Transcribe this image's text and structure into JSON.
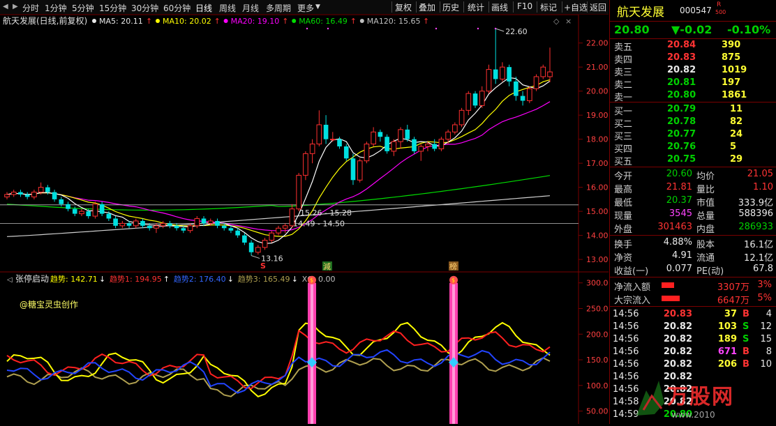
{
  "toolbar": {
    "left_tabs": [
      "分时",
      "1分钟",
      "5分钟",
      "15分钟",
      "30分钟",
      "60分钟",
      "日线",
      "周线",
      "月线",
      "多周期",
      "更多"
    ],
    "active_tab": "日线",
    "right_buttons": [
      "复权",
      "叠加",
      "历史",
      "统计",
      "画线",
      "F10",
      "标记",
      "+自选",
      "返回"
    ]
  },
  "chart": {
    "title": "航天发展(日线,前复权)",
    "ma": [
      {
        "label": "MA5: 20.11",
        "arrow": "↑",
        "color": "#e8e8e8"
      },
      {
        "label": "MA10: 20.02",
        "arrow": "↑",
        "color": "#ffff00"
      },
      {
        "label": "MA20: 19.10",
        "arrow": "↑",
        "color": "#ff00ff"
      },
      {
        "label": "MA60: 16.49",
        "arrow": "↑",
        "color": "#00dd00"
      },
      {
        "label": "MA120: 15.65",
        "arrow": "↑",
        "color": "#c0c0c0"
      }
    ],
    "ma_arrow_color": "#ff3333",
    "price_axis": [
      "22.00",
      "21.00",
      "20.00",
      "19.00",
      "18.00",
      "17.00",
      "16.00",
      "15.00",
      "14.00",
      "13.00"
    ],
    "annotations": {
      "high": "22.60",
      "low": "13.16",
      "range1": "15.26 - 15.28",
      "range2": "14.49 - 14.50",
      "mark_s": "S",
      "mark_jian": "減",
      "mark_bang": "榜"
    }
  },
  "chart_data": [
    {
      "type": "bar",
      "title": "航天发展(日线,前复权)",
      "categories": [],
      "series": [
        {
          "name": "MA5",
          "values": [
            20.11
          ]
        },
        {
          "name": "MA10",
          "values": [
            20.02
          ]
        },
        {
          "name": "MA20",
          "values": [
            19.1
          ]
        },
        {
          "name": "MA60",
          "values": [
            16.49
          ]
        },
        {
          "name": "MA120",
          "values": [
            15.65
          ]
        }
      ],
      "ylim": [
        12.8,
        22.6
      ],
      "yticks": [
        13,
        14,
        15,
        16,
        17,
        18,
        19,
        20,
        21,
        22
      ],
      "high": 22.6,
      "low": 13.16,
      "grid": false,
      "candles": [
        [
          15.6,
          15.8,
          15.5,
          15.7
        ],
        [
          15.7,
          15.9,
          15.6,
          15.8
        ],
        [
          15.8,
          15.9,
          15.6,
          15.7
        ],
        [
          15.7,
          15.8,
          15.5,
          15.6
        ],
        [
          15.6,
          15.9,
          15.5,
          15.8
        ],
        [
          15.8,
          16.2,
          15.7,
          16.0
        ],
        [
          16.0,
          16.1,
          15.7,
          15.8
        ],
        [
          15.8,
          15.9,
          15.4,
          15.5
        ],
        [
          15.5,
          15.6,
          15.2,
          15.3
        ],
        [
          15.3,
          15.4,
          15.0,
          15.1
        ],
        [
          15.1,
          15.2,
          14.8,
          14.9
        ],
        [
          14.9,
          15.1,
          14.8,
          15.0
        ],
        [
          15.0,
          15.1,
          14.7,
          14.8
        ],
        [
          14.8,
          15.4,
          14.7,
          15.3
        ],
        [
          15.3,
          15.4,
          14.8,
          14.9
        ],
        [
          14.9,
          15.0,
          14.6,
          14.7
        ],
        [
          14.7,
          14.8,
          14.3,
          14.4
        ],
        [
          14.4,
          14.6,
          14.3,
          14.5
        ],
        [
          14.5,
          14.6,
          14.3,
          14.4
        ],
        [
          14.4,
          14.7,
          14.3,
          14.6
        ],
        [
          14.6,
          14.7,
          14.3,
          14.4
        ],
        [
          14.4,
          14.5,
          14.2,
          14.3
        ],
        [
          14.3,
          14.5,
          14.1,
          14.4
        ],
        [
          14.4,
          14.6,
          14.3,
          14.5
        ],
        [
          14.5,
          14.6,
          14.3,
          14.4
        ],
        [
          14.4,
          14.5,
          14.2,
          14.3
        ],
        [
          14.3,
          14.4,
          14.1,
          14.2
        ],
        [
          14.2,
          14.5,
          14.1,
          14.4
        ],
        [
          14.4,
          14.8,
          14.3,
          14.7
        ],
        [
          14.7,
          14.8,
          14.4,
          14.5
        ],
        [
          14.5,
          14.7,
          14.4,
          14.6
        ],
        [
          14.6,
          14.7,
          14.3,
          14.4
        ],
        [
          14.4,
          14.5,
          14.2,
          14.3
        ],
        [
          14.3,
          14.4,
          14.1,
          14.2
        ],
        [
          14.2,
          14.3,
          13.9,
          14.0
        ],
        [
          14.0,
          14.1,
          13.6,
          13.7
        ],
        [
          13.7,
          13.8,
          13.16,
          13.3
        ],
        [
          13.3,
          13.6,
          13.2,
          13.5
        ],
        [
          13.5,
          13.9,
          13.4,
          13.8
        ],
        [
          13.8,
          14.2,
          13.7,
          14.1
        ],
        [
          14.1,
          14.4,
          14.0,
          14.3
        ],
        [
          14.3,
          14.5,
          14.1,
          14.4
        ],
        [
          14.4,
          15.3,
          14.3,
          15.1
        ],
        [
          15.1,
          16.6,
          15.0,
          16.5
        ],
        [
          16.5,
          17.5,
          16.3,
          17.4
        ],
        [
          17.4,
          18.0,
          17.0,
          17.8
        ],
        [
          17.8,
          19.2,
          17.7,
          18.6
        ],
        [
          18.6,
          19.0,
          17.8,
          18.0
        ],
        [
          18.0,
          18.3,
          17.9,
          18.0
        ],
        [
          18.0,
          18.1,
          17.6,
          17.7
        ],
        [
          17.7,
          17.8,
          17.1,
          17.2
        ],
        [
          17.2,
          17.4,
          16.1,
          16.3
        ],
        [
          16.3,
          17.2,
          16.2,
          17.1
        ],
        [
          17.1,
          17.9,
          17.0,
          17.8
        ],
        [
          17.8,
          18.5,
          17.7,
          18.3
        ],
        [
          18.3,
          18.4,
          17.9,
          18.1
        ],
        [
          18.1,
          18.2,
          17.4,
          17.5
        ],
        [
          17.5,
          18.0,
          17.3,
          17.9
        ],
        [
          17.9,
          18.5,
          17.6,
          18.4
        ],
        [
          18.4,
          18.6,
          17.9,
          18.0
        ],
        [
          18.0,
          18.1,
          17.4,
          17.5
        ],
        [
          17.5,
          17.8,
          17.1,
          17.7
        ],
        [
          17.7,
          17.9,
          17.5,
          17.8
        ],
        [
          17.8,
          18.0,
          17.5,
          17.6
        ],
        [
          17.6,
          18.1,
          17.5,
          18.0
        ],
        [
          18.0,
          18.4,
          17.8,
          18.3
        ],
        [
          18.3,
          18.7,
          18.2,
          18.6
        ],
        [
          18.6,
          19.3,
          18.5,
          19.2
        ],
        [
          19.2,
          20.0,
          19.0,
          19.9
        ],
        [
          19.9,
          20.0,
          19.3,
          19.4
        ],
        [
          19.4,
          20.2,
          19.3,
          20.0
        ],
        [
          20.0,
          21.1,
          19.9,
          20.9
        ],
        [
          20.9,
          22.6,
          20.3,
          20.5
        ],
        [
          20.5,
          21.2,
          20.4,
          21.0
        ],
        [
          21.0,
          21.1,
          20.2,
          20.4
        ],
        [
          20.4,
          20.6,
          19.6,
          19.8
        ],
        [
          19.8,
          20.0,
          19.4,
          19.6
        ],
        [
          19.6,
          20.2,
          19.5,
          20.1
        ],
        [
          20.1,
          20.7,
          20.0,
          20.6
        ],
        [
          20.6,
          21.1,
          20.5,
          21.0
        ],
        [
          20.6,
          21.81,
          20.37,
          20.8
        ]
      ]
    },
    {
      "type": "line",
      "title": "张停启动",
      "series": [
        {
          "name": "趋势",
          "values": [
            142.71
          ]
        },
        {
          "name": "趋势1",
          "values": [
            194.95
          ]
        },
        {
          "name": "趋势2",
          "values": [
            176.4
          ]
        },
        {
          "name": "趋势3",
          "values": [
            165.49
          ]
        },
        {
          "name": "XG",
          "values": [
            0.0
          ]
        }
      ],
      "ylim": [
        25,
        320
      ],
      "yticks": [
        50,
        100,
        150,
        200,
        250,
        300
      ]
    }
  ],
  "indicator": {
    "name": "张停启动",
    "items": [
      {
        "label": "趋势: 142.71",
        "color": "#ffff00",
        "arrow": "↓"
      },
      {
        "label": "趋势1: 194.95",
        "color": "#ff3333",
        "arrow": "↑"
      },
      {
        "label": "趋势2: 176.40",
        "color": "#3366ff",
        "arrow": "↓"
      },
      {
        "label": "趋势3: 165.49",
        "color": "#b0a050",
        "arrow": "↓"
      },
      {
        "label": "XG: 0.00",
        "color": "#c0c0c0",
        "arrow": ""
      }
    ],
    "watermark": "@糖宝灵虫创作",
    "axis": [
      "300.0",
      "250.0",
      "200.0",
      "150.0",
      "100.0",
      "50.00"
    ]
  },
  "quote": {
    "name": "航天发展",
    "code": "000547",
    "badge_r": "R",
    "badge_num": "500",
    "price": "20.80",
    "change": "▼-0.02",
    "pct": "-0.10%",
    "asks": [
      {
        "label": "卖五",
        "price": "20.84",
        "vol": "390",
        "pc": "red"
      },
      {
        "label": "卖四",
        "price": "20.83",
        "vol": "875",
        "pc": "red"
      },
      {
        "label": "卖三",
        "price": "20.82",
        "vol": "1019",
        "pc": "wht"
      },
      {
        "label": "卖二",
        "price": "20.81",
        "vol": "197",
        "pc": "grn"
      },
      {
        "label": "卖一",
        "price": "20.80",
        "vol": "1861",
        "pc": "grn"
      }
    ],
    "bids": [
      {
        "label": "买一",
        "price": "20.79",
        "vol": "11",
        "pc": "grn"
      },
      {
        "label": "买二",
        "price": "20.78",
        "vol": "82",
        "pc": "grn"
      },
      {
        "label": "买三",
        "price": "20.77",
        "vol": "24",
        "pc": "grn"
      },
      {
        "label": "买四",
        "price": "20.76",
        "vol": "5",
        "pc": "grn"
      },
      {
        "label": "买五",
        "price": "20.75",
        "vol": "29",
        "pc": "grn"
      }
    ],
    "stats": [
      {
        "l1": "今开",
        "v1": "20.60",
        "c1": "grn",
        "l2": "均价",
        "v2": "21.05",
        "c2": "red"
      },
      {
        "l1": "最高",
        "v1": "21.81",
        "c1": "red",
        "l2": "量比",
        "v2": "1.10",
        "c2": "red"
      },
      {
        "l1": "最低",
        "v1": "20.37",
        "c1": "grn",
        "l2": "市值",
        "v2": "333.9亿",
        "c2": "wht"
      },
      {
        "l1": "现量",
        "v1": "3545",
        "c1": "mag",
        "l2": "总量",
        "v2": "588396",
        "c2": "wht"
      },
      {
        "l1": "外盘",
        "v1": "301463",
        "c1": "red",
        "l2": "内盘",
        "v2": "286933",
        "c2": "grn"
      }
    ],
    "stats2": [
      {
        "l1": "换手",
        "v1": "4.88%",
        "c1": "wht",
        "l2": "股本",
        "v2": "16.1亿",
        "c2": "wht"
      },
      {
        "l1": "净资",
        "v1": "4.91",
        "c1": "wht",
        "l2": "流通",
        "v2": "12.1亿",
        "c2": "wht"
      },
      {
        "l1": "收益(一)",
        "v1": "0.077",
        "c1": "wht",
        "l2": "PE(动)",
        "v2": "67.8",
        "c2": "wht"
      }
    ],
    "flows": [
      {
        "label": "净流入额",
        "value": "3307万",
        "pct": "3%",
        "bar": 0.6
      },
      {
        "label": "大宗流入",
        "value": "6647万",
        "pct": "5%",
        "bar": 0.85
      }
    ],
    "ticks": [
      {
        "t": "14:56",
        "p": "20.83",
        "pc": "red",
        "v": "37",
        "vc": "yel",
        "s": "B",
        "sc": "red",
        "n": "4"
      },
      {
        "t": "14:56",
        "p": "20.82",
        "pc": "wht",
        "v": "103",
        "vc": "yel",
        "s": "S",
        "sc": "grn",
        "n": "12"
      },
      {
        "t": "14:56",
        "p": "20.82",
        "pc": "wht",
        "v": "189",
        "vc": "yel",
        "s": "S",
        "sc": "grn",
        "n": "15"
      },
      {
        "t": "14:56",
        "p": "20.82",
        "pc": "wht",
        "v": "671",
        "vc": "mag",
        "s": "B",
        "sc": "red",
        "n": "8"
      },
      {
        "t": "14:56",
        "p": "20.82",
        "pc": "wht",
        "v": "206",
        "vc": "yel",
        "s": "B",
        "sc": "red",
        "n": "10"
      },
      {
        "t": "14:56",
        "p": "20.82",
        "pc": "wht",
        "v": "",
        "vc": "yel",
        "s": "",
        "sc": "grn",
        "n": ""
      },
      {
        "t": "14:56",
        "p": "20.82",
        "pc": "wht",
        "v": "",
        "vc": "yel",
        "s": "",
        "sc": "grn",
        "n": ""
      },
      {
        "t": "14:58",
        "p": "20.82",
        "pc": "wht",
        "v": "",
        "vc": "yel",
        "s": "",
        "sc": "grn",
        "n": ""
      },
      {
        "t": "14:59",
        "p": "20.80",
        "pc": "grn",
        "v": "",
        "vc": "yel",
        "s": "",
        "sc": "grn",
        "n": ""
      }
    ],
    "logo_text": "万股网",
    "logo_url": "www.2010"
  }
}
